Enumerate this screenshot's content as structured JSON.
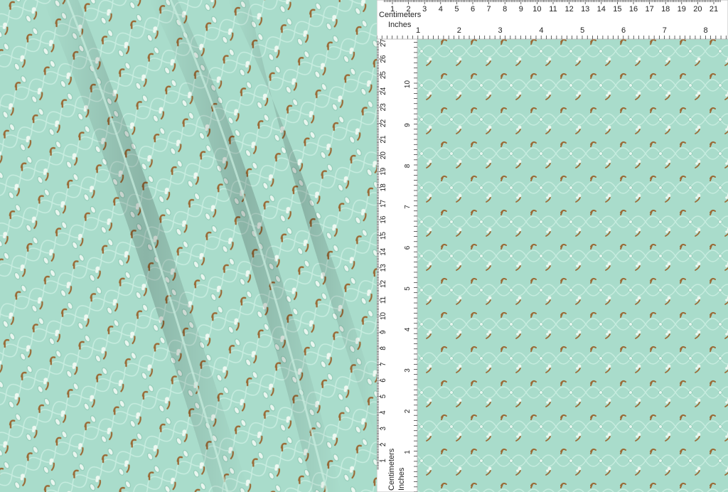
{
  "colors": {
    "fabric": "#a9dccb",
    "fabric_shadow": "#86c4b0",
    "fabric_highlight": "#c4eadc",
    "motif_brown": "#9a6a36",
    "motif_white": "#eef8f1",
    "ruler": "#ffffff",
    "ruler_ink": "#222222"
  },
  "ruler_top": {
    "centimeters_label": "Centimeters",
    "inches_label": "Inches",
    "cm_ticks": [
      "1",
      "2",
      "3",
      "4",
      "5",
      "6",
      "7",
      "8",
      "9",
      "10",
      "11",
      "12",
      "13",
      "14",
      "15",
      "16",
      "17",
      "18",
      "19",
      "20",
      "21"
    ],
    "in_ticks": [
      "1",
      "2",
      "3",
      "4",
      "5",
      "6",
      "7",
      "8"
    ]
  },
  "ruler_left": {
    "centimeters_label": "Centimeters",
    "inches_label": "Inches",
    "cm_ticks": [
      "1",
      "2",
      "3",
      "4",
      "5",
      "6",
      "7",
      "8",
      "9",
      "10",
      "11",
      "12",
      "13",
      "14",
      "15",
      "16",
      "17",
      "18",
      "19",
      "20",
      "21",
      "22",
      "23",
      "24",
      "25",
      "26",
      "27"
    ],
    "in_ticks": [
      "1",
      "2",
      "3",
      "4",
      "5",
      "6",
      "7",
      "8",
      "9",
      "10"
    ]
  }
}
